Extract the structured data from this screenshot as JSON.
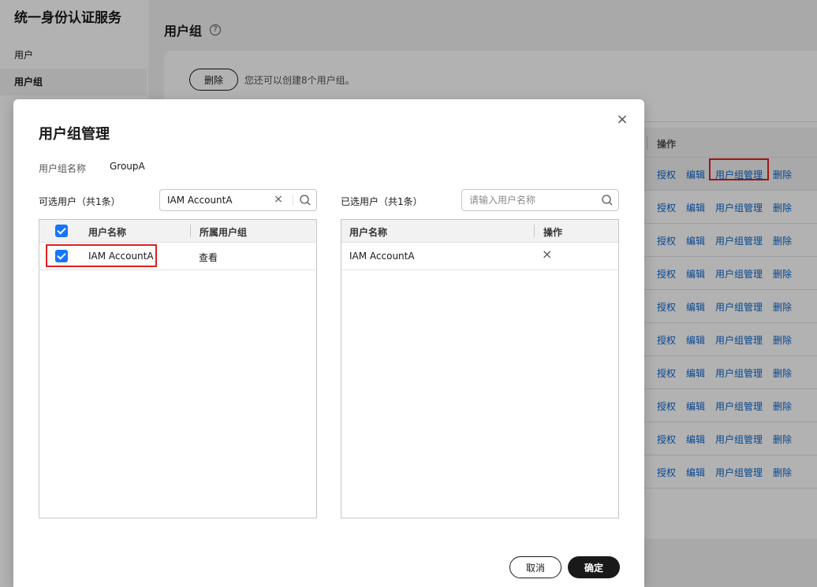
{
  "app": {
    "brand": "统一身份认证服务",
    "nav": [
      {
        "label": "用户"
      },
      {
        "label": "用户组"
      }
    ]
  },
  "page": {
    "title": "用户组",
    "help_icon": "?",
    "delete_button": "删除",
    "quota_text": "您还可以创建8个用户组。",
    "ops_header": "操作",
    "row_actions": {
      "authorize": "授权",
      "edit": "编辑",
      "manage": "用户组管理",
      "delete": "删除"
    }
  },
  "modal": {
    "title": "用户组管理",
    "close_icon": "×",
    "group_name_label": "用户组名称",
    "group_name_value": "GroupA",
    "available": {
      "caption": "可选用户（共1条）",
      "search_value": "IAM AccountA",
      "clear_icon": "×",
      "columns": [
        "用户名称",
        "所属用户组"
      ],
      "rows": [
        {
          "name": "IAM AccountA",
          "action": "查看",
          "checked": true
        }
      ]
    },
    "selected": {
      "caption": "已选用户（共1条）",
      "search_placeholder": "请输入用户名称",
      "columns": [
        "用户名称",
        "操作"
      ],
      "rows": [
        {
          "name": "IAM AccountA",
          "remove_icon": "×"
        }
      ]
    },
    "cancel_button": "取消",
    "confirm_button": "确定"
  },
  "colors": {
    "accent": "#1476ff",
    "link": "#0a66d0",
    "highlight": "#e02020",
    "primary_button": "#191919"
  }
}
